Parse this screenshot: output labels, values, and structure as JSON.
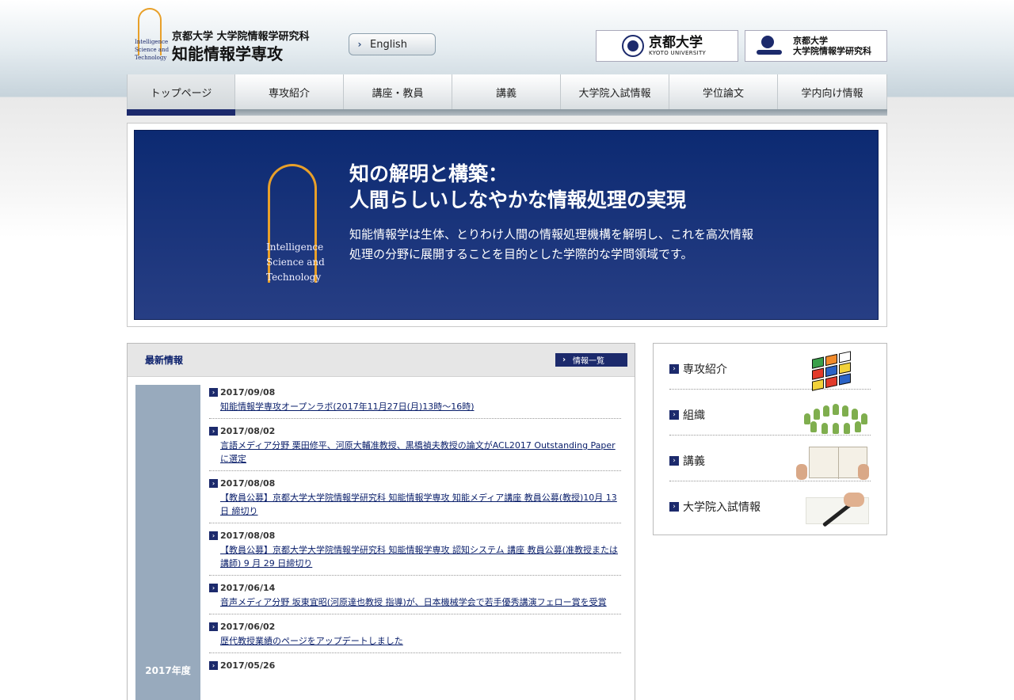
{
  "header": {
    "logo_small_lines": [
      "Intelligence",
      "Science and",
      "Technology"
    ],
    "logo_jp_line1": "京都大学 大学院情報学研究科",
    "logo_jp_line2": "知能情報学専攻",
    "english_button": "English",
    "kyoto_u_jp": "京都大学",
    "kyoto_u_en": "KYOTO UNIVERSITY",
    "gs_line1": "京都大学",
    "gs_line2": "大学院情報学研究科"
  },
  "nav": {
    "items": [
      "トップページ",
      "専攻紹介",
      "講座・教員",
      "講義",
      "大学院入試情報",
      "学位論文",
      "学内向け情報"
    ],
    "active_index": 0
  },
  "hero": {
    "small_lines": [
      "Intelligence",
      "Science and",
      "Technology"
    ],
    "title_line1": "知の解明と構築：",
    "title_line2": "人間らしいしなやかな情報処理の実現",
    "description": "知能情報学は生体、とりわけ人間の情報処理機構を解明し、これを高次情報処理の分野に展開することを目的とした学際的な学問領域です。"
  },
  "news": {
    "title": "最新情報",
    "list_button": "情報一覧",
    "year_label": "2017年度",
    "entries": [
      {
        "date": "2017/09/08",
        "text": "知能情報学専攻オープンラボ(2017年11月27日(月)13時～16時)"
      },
      {
        "date": "2017/08/02",
        "text": "言語メディア分野 栗田修平、河原大輔准教授、黒橋禎夫教授の論文がACL2017 Outstanding Paperに選定"
      },
      {
        "date": "2017/08/08",
        "text": "【教員公募】京都大学大学院情報学研究科 知能情報学専攻 知能メディア講座 教員公募(教授)10月 13日 締切り"
      },
      {
        "date": "2017/08/08",
        "text": "【教員公募】京都大学大学院情報学研究科 知能情報学専攻 認知システム 講座 教員公募(准教授または講師) 9 月 29 日締切り"
      },
      {
        "date": "2017/06/14",
        "text": "音声メディア分野 坂東宜昭(河原達也教授 指導)が、日本機械学会で若手優秀講演フェロー賞を受賞"
      },
      {
        "date": "2017/06/02",
        "text": "歴代教授業績のページをアップデートしました"
      },
      {
        "date": "2017/05/26",
        "text": ""
      }
    ]
  },
  "side": {
    "items": [
      {
        "label": "専攻紹介",
        "icon": "rubiks-cube-image"
      },
      {
        "label": "組織",
        "icon": "people-ring-image"
      },
      {
        "label": "講義",
        "icon": "notebook-image"
      },
      {
        "label": "大学院入試情報",
        "icon": "pen-writing-image"
      }
    ]
  },
  "colors": {
    "navy": "#1c2a6c",
    "hero_blue": "#0c2a72",
    "accent_gold": "#e8a02a",
    "year_column": "#98aabd"
  }
}
